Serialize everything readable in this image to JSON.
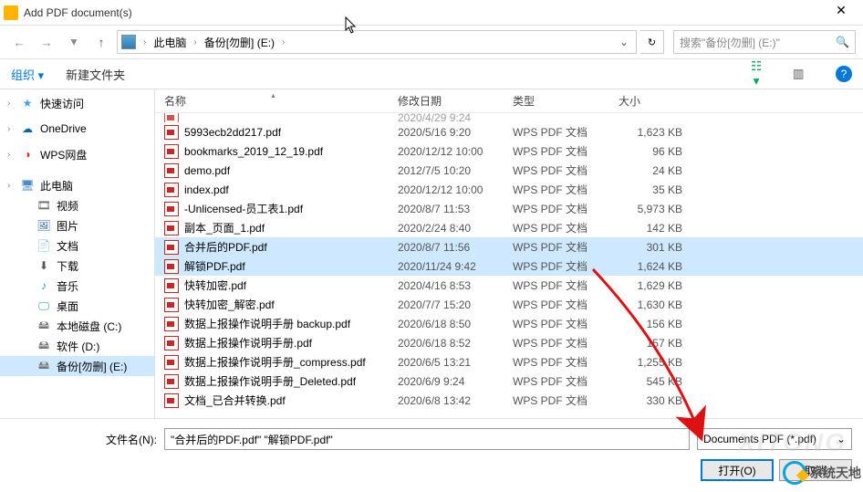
{
  "window": {
    "title": "Add PDF document(s)"
  },
  "breadcrumb": {
    "pc": "此电脑",
    "drive": "备份[勿删] (E:)"
  },
  "search": {
    "placeholder": "搜索\"备份[勿删] (E:)\""
  },
  "toolbar": {
    "organize": "组织 ▾",
    "new_folder": "新建文件夹"
  },
  "columns": {
    "name": "名称",
    "date": "修改日期",
    "type": "类型",
    "size": "大小"
  },
  "sidebar": [
    {
      "icon": "star",
      "label": "快速访问",
      "exp": true
    },
    {
      "icon": "cloud",
      "label": "OneDrive",
      "exp": true
    },
    {
      "icon": "wps",
      "label": "WPS网盘",
      "exp": true
    },
    {
      "icon": "pc",
      "label": "此电脑",
      "exp": true
    },
    {
      "icon": "video",
      "label": "视频",
      "indent": true
    },
    {
      "icon": "pic",
      "label": "图片",
      "indent": true
    },
    {
      "icon": "doc",
      "label": "文档",
      "indent": true
    },
    {
      "icon": "down",
      "label": "下载",
      "indent": true
    },
    {
      "icon": "music",
      "label": "音乐",
      "indent": true
    },
    {
      "icon": "desk",
      "label": "桌面",
      "indent": true
    },
    {
      "icon": "disk",
      "label": "本地磁盘 (C:)",
      "indent": true
    },
    {
      "icon": "disk",
      "label": "软件 (D:)",
      "indent": true
    },
    {
      "icon": "disk",
      "label": "备份[勿删] (E:)",
      "indent": true,
      "sel": true
    }
  ],
  "cut_row": {
    "date": "2020/4/29 9:24"
  },
  "files": [
    {
      "name": "5993ecb2dd217.pdf",
      "date": "2020/5/16 9:20",
      "type": "WPS PDF 文档",
      "size": "1,623 KB"
    },
    {
      "name": "bookmarks_2019_12_19.pdf",
      "date": "2020/12/12 10:00",
      "type": "WPS PDF 文档",
      "size": "96 KB"
    },
    {
      "name": "demo.pdf",
      "date": "2012/7/5 10:20",
      "type": "WPS PDF 文档",
      "size": "24 KB"
    },
    {
      "name": "index.pdf",
      "date": "2020/12/12 10:00",
      "type": "WPS PDF 文档",
      "size": "35 KB"
    },
    {
      "name": "-Unlicensed-员工表1.pdf",
      "date": "2020/8/7 11:53",
      "type": "WPS PDF 文档",
      "size": "5,973 KB"
    },
    {
      "name": "副本_页面_1.pdf",
      "date": "2020/2/24 8:40",
      "type": "WPS PDF 文档",
      "size": "142 KB"
    },
    {
      "name": "合并后的PDF.pdf",
      "date": "2020/8/7 11:56",
      "type": "WPS PDF 文档",
      "size": "301 KB",
      "sel": true
    },
    {
      "name": "解锁PDF.pdf",
      "date": "2020/11/24 9:42",
      "type": "WPS PDF 文档",
      "size": "1,624 KB",
      "sel": true
    },
    {
      "name": "快转加密.pdf",
      "date": "2020/4/16 8:53",
      "type": "WPS PDF 文档",
      "size": "1,629 KB"
    },
    {
      "name": "快转加密_解密.pdf",
      "date": "2020/7/7 15:20",
      "type": "WPS PDF 文档",
      "size": "1,630 KB"
    },
    {
      "name": "数据上报操作说明手册 backup.pdf",
      "date": "2020/6/18 8:50",
      "type": "WPS PDF 文档",
      "size": "156 KB"
    },
    {
      "name": "数据上报操作说明手册.pdf",
      "date": "2020/6/18 8:52",
      "type": "WPS PDF 文档",
      "size": "157 KB"
    },
    {
      "name": "数据上报操作说明手册_compress.pdf",
      "date": "2020/6/5 13:21",
      "type": "WPS PDF 文档",
      "size": "1,255 KB"
    },
    {
      "name": "数据上报操作说明手册_Deleted.pdf",
      "date": "2020/6/9 9:24",
      "type": "WPS PDF 文档",
      "size": "545 KB"
    },
    {
      "name": "文档_已合并转换.pdf",
      "date": "2020/6/8 13:42",
      "type": "WPS PDF 文档",
      "size": "330 KB"
    }
  ],
  "footer": {
    "filename_label": "文件名(N):",
    "filename_value": "\"合并后的PDF.pdf\" \"解锁PDF.pdf\"",
    "filetype": "Documents PDF (*.pdf)",
    "open": "打开(O)",
    "cancel": "取消"
  },
  "watermark": "系统天地"
}
